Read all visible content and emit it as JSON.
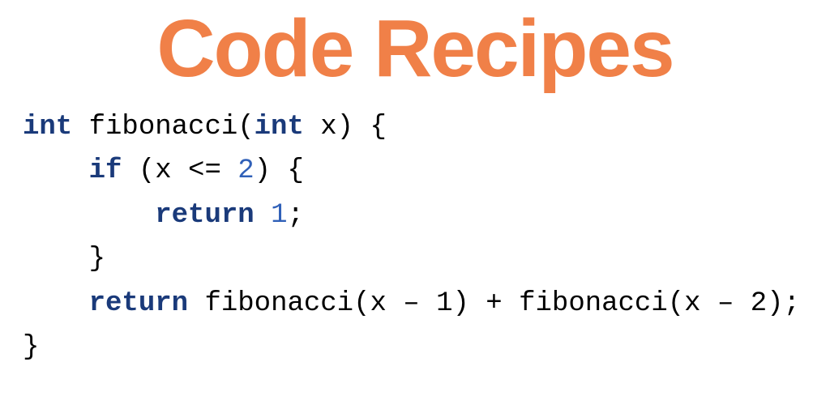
{
  "title": "Code Recipes",
  "code": {
    "l1_kw1": "int",
    "l1_fn": " fibonacci(",
    "l1_kw2": "int",
    "l1_rest": " x) {",
    "l2_indent": "    ",
    "l2_kw": "if",
    "l2_rest_a": " (x <= ",
    "l2_num": "2",
    "l2_rest_b": ") {",
    "l3_indent": "        ",
    "l3_kw": "return",
    "l3_sp": " ",
    "l3_num": "1",
    "l3_semi": ";",
    "l4_indent": "    ",
    "l4_brace": "}",
    "l5_indent": "    ",
    "l5_kw": "return",
    "l5_rest": " fibonacci(x – 1) + fibonacci(x – 2);",
    "l6": "}"
  }
}
